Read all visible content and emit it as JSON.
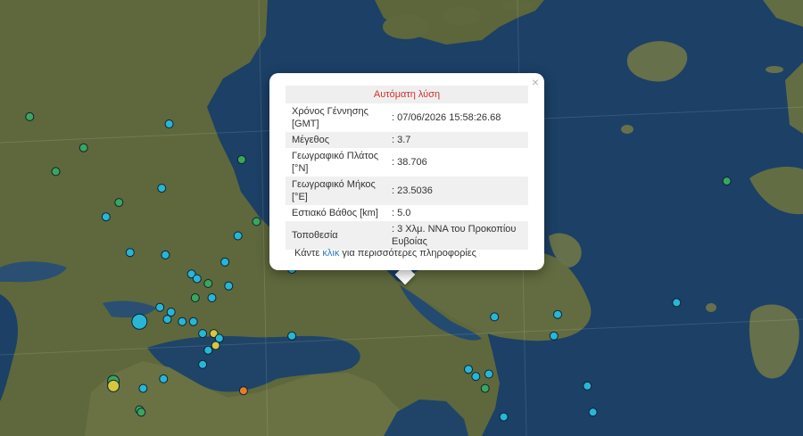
{
  "map": {
    "colors": {
      "sea": "#1b3f63",
      "land": "#5f6a3e",
      "event_recent": "#27b7d4",
      "event_older": "#3aa659",
      "event_orange": "#e87d1f",
      "event_yellow": "#d6c73c",
      "selected_star": "#2fd0ee"
    },
    "events": [
      {
        "lat": 39.27,
        "lon": 20.98,
        "cat": "green"
      },
      {
        "lat": 39.24,
        "lon": 21.73,
        "cat": "cyan"
      },
      {
        "lat": 39.14,
        "lon": 21.27,
        "cat": "green"
      },
      {
        "lat": 39.04,
        "lon": 21.12,
        "cat": "green"
      },
      {
        "lat": 38.97,
        "lon": 21.69,
        "cat": "cyan"
      },
      {
        "lat": 38.91,
        "lon": 21.46,
        "cat": "green"
      },
      {
        "lat": 38.85,
        "lon": 21.39,
        "cat": "cyan"
      },
      {
        "lat": 38.7,
        "lon": 21.52,
        "cat": "cyan"
      },
      {
        "lat": 38.69,
        "lon": 21.71,
        "cat": "cyan"
      },
      {
        "lat": 38.66,
        "lon": 22.03,
        "cat": "cyan"
      },
      {
        "lat": 38.61,
        "lon": 21.85,
        "cat": "cyan"
      },
      {
        "lat": 38.59,
        "lon": 21.88,
        "cat": "cyan"
      },
      {
        "lat": 38.56,
        "lon": 22.05,
        "cat": "cyan"
      },
      {
        "lat": 38.57,
        "lon": 21.94,
        "cat": "green"
      },
      {
        "lat": 38.51,
        "lon": 21.87,
        "cat": "green"
      },
      {
        "lat": 38.51,
        "lon": 21.96,
        "cat": "cyan"
      },
      {
        "lat": 38.47,
        "lon": 21.68,
        "cat": "cyan"
      },
      {
        "lat": 38.45,
        "lon": 21.74,
        "cat": "cyan"
      },
      {
        "lat": 38.41,
        "lon": 21.57,
        "cat": "cyan",
        "size": "large"
      },
      {
        "lat": 38.42,
        "lon": 21.72,
        "cat": "cyan"
      },
      {
        "lat": 38.41,
        "lon": 21.8,
        "cat": "cyan"
      },
      {
        "lat": 38.41,
        "lon": 21.86,
        "cat": "cyan"
      },
      {
        "lat": 38.36,
        "lon": 21.91,
        "cat": "cyan"
      },
      {
        "lat": 38.36,
        "lon": 21.97,
        "cat": "yellow"
      },
      {
        "lat": 38.34,
        "lon": 22.0,
        "cat": "cyan"
      },
      {
        "lat": 38.31,
        "lon": 21.98,
        "cat": "yellow"
      },
      {
        "lat": 38.29,
        "lon": 21.94,
        "cat": "cyan"
      },
      {
        "lat": 38.35,
        "lon": 22.39,
        "cat": "cyan"
      },
      {
        "lat": 38.23,
        "lon": 21.91,
        "cat": "cyan"
      },
      {
        "lat": 38.16,
        "lon": 21.43,
        "cat": "green",
        "size": "medium"
      },
      {
        "lat": 38.14,
        "lon": 21.43,
        "cat": "yellow",
        "size": "medium"
      },
      {
        "lat": 38.17,
        "lon": 21.7,
        "cat": "cyan"
      },
      {
        "lat": 38.13,
        "lon": 21.59,
        "cat": "cyan"
      },
      {
        "lat": 38.12,
        "lon": 22.13,
        "cat": "orange"
      },
      {
        "lat": 38.04,
        "lon": 21.57,
        "cat": "green"
      },
      {
        "lat": 38.03,
        "lon": 21.58,
        "cat": "green"
      },
      {
        "lat": 38.21,
        "lon": 23.34,
        "cat": "cyan"
      },
      {
        "lat": 38.18,
        "lon": 23.38,
        "cat": "cyan"
      },
      {
        "lat": 38.19,
        "lon": 23.45,
        "cat": "cyan"
      },
      {
        "lat": 38.13,
        "lon": 23.43,
        "cat": "green"
      },
      {
        "lat": 38.01,
        "lon": 23.53,
        "cat": "cyan"
      },
      {
        "lat": 38.14,
        "lon": 23.98,
        "cat": "cyan"
      },
      {
        "lat": 38.03,
        "lon": 24.01,
        "cat": "cyan"
      },
      {
        "lat": 38.35,
        "lon": 23.8,
        "cat": "cyan"
      },
      {
        "lat": 38.44,
        "lon": 23.82,
        "cat": "cyan"
      },
      {
        "lat": 38.43,
        "lon": 23.48,
        "cat": "cyan"
      },
      {
        "lat": 38.73,
        "lon": 23.46,
        "cat": "cyan",
        "size": "large"
      },
      {
        "lat": 38.72,
        "lon": 23.45,
        "cat": "green",
        "size": "medium"
      },
      {
        "lat": 38.72,
        "lon": 23.48,
        "cat": "cyan"
      },
      {
        "lat": 39.0,
        "lon": 24.73,
        "cat": "green"
      },
      {
        "lat": 38.49,
        "lon": 24.46,
        "cat": "cyan"
      },
      {
        "lat": 39.06,
        "lon": 22.68,
        "cat": "green"
      },
      {
        "lat": 39.09,
        "lon": 22.12,
        "cat": "green"
      },
      {
        "lat": 38.83,
        "lon": 22.2,
        "cat": "green"
      },
      {
        "lat": 38.77,
        "lon": 22.1,
        "cat": "cyan"
      },
      {
        "lat": 38.63,
        "lon": 22.39,
        "cat": "cyan"
      }
    ],
    "selected": {
      "lat": 38.706,
      "lon": 23.5036,
      "magnitude": 3.7
    }
  },
  "popup": {
    "header": "Αυτόματη λύση",
    "rows": [
      {
        "label": "Χρόνος Γέννησης [GMT]",
        "value": ": 07/06/2026 15:58:26.68"
      },
      {
        "label": "Μέγεθος",
        "value": ": 3.7"
      },
      {
        "label": "Γεωγραφικό Πλάτος [°N]",
        "value": ": 38.706"
      },
      {
        "label": "Γεωγραφικό Μήκος [°E]",
        "value": ": 23.5036"
      },
      {
        "label": "Εστιακό Βάθος [km]",
        "value": ": 5.0"
      },
      {
        "label": "Τοποθεσία",
        "value": ": 3 Χλμ. ΝΝΑ του Προκοπίου Ευβοίας"
      }
    ],
    "footer_before": "Κάντε ",
    "footer_link": "κλικ",
    "footer_after": " για περισσότερες πληροφορίες",
    "close_glyph": "×"
  }
}
